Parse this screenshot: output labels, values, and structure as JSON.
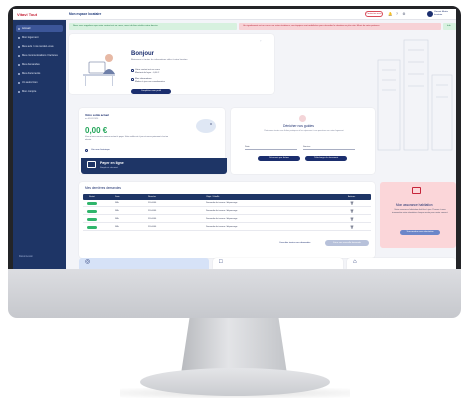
{
  "header": {
    "logo": "Vitavi Tout",
    "space_title": "Mon espace locataire",
    "contact_label": "Contactez-nous",
    "user_name": "Vincent Martin",
    "user_sub": "locataire"
  },
  "sidebar": {
    "items": [
      {
        "label": "Accueil"
      },
      {
        "label": "Mon logement"
      },
      {
        "label": "Mes avis / nos rendez-vous"
      },
      {
        "label": "Mes communications / factures"
      },
      {
        "label": "Mes demandes"
      },
      {
        "label": "Mes documents"
      },
      {
        "label": "Un autre bien"
      },
      {
        "label": "Mon compte"
      }
    ],
    "footer": "Déconnexion"
  },
  "alerts": {
    "green": "Nous vous rappelons que votre contrat est en cours, merci de bien vérifier votre dossier",
    "red": "Un signalement est en cours sur votre résidence, nos équipes sont mobilisées pour résoudre la situation au plus vite. Merci de votre patience",
    "green2": "Info"
  },
  "hero": {
    "title": "Bonjour",
    "subtitle": "Retrouvez ici toutes les informations utiles à votre location",
    "line1": "Votre contrat est en cours",
    "line1b": "Montant du loyer : 0,00 €",
    "line2": "Mes informations",
    "line2b": "Mettez à jour vos coordonnées",
    "button": "Compléter mon profil"
  },
  "balance": {
    "title": "Votre solde actuel",
    "date": "au 01/01/2024",
    "amount": "0,00 €",
    "text": "Vous n'avez aucune somme restant à payer. Votre solde est à jour et aucun paiement n'est en attente.",
    "link": "Voir mon historique",
    "pay_title": "Payer en ligne",
    "pay_sub": "Simple et sécurisé"
  },
  "guide": {
    "title": "Dénicher nos guides",
    "subtitle": "Retrouvez toutes nos fiches pratiques et les réponses à vos questions sur votre logement",
    "field1": "Date",
    "field2": "Service",
    "button1": "Découvrir par thème",
    "button2": "Télécharger le document"
  },
  "requests": {
    "title": "Mes dernières demandes",
    "columns": [
      "Statut",
      "Date",
      "Numéro",
      "Objet / Libellé",
      "Actions"
    ],
    "rows": [
      {
        "date": "N/A",
        "number": "DX-0000",
        "object": "Demande de travaux / dépannage"
      },
      {
        "date": "N/A",
        "number": "DX-0000",
        "object": "Demande de travaux / dépannage"
      },
      {
        "date": "N/A",
        "number": "DX-0000",
        "object": "Demande de travaux / dépannage"
      },
      {
        "date": "N/A",
        "number": "DX-0000",
        "object": "Demande de travaux / dépannage"
      }
    ],
    "view_all": "Consulter toutes mes demandes",
    "new_button": "Faire une nouvelle demande"
  },
  "promo": {
    "title": "Mon assurance habitation",
    "text": "Votre assurance habitation doit être à jour. Pensez à nous transmettre votre attestation chaque année pour rester couvert.",
    "button": "Transmettre mon attestation"
  },
  "colors": {
    "navy": "#1e3566",
    "brand_red": "#c6253a",
    "success": "#23a559",
    "alert_red_bg": "#f7d2d6"
  },
  "icons": [
    "bell-icon",
    "gear-icon",
    "credit-card-icon",
    "lightbulb-icon",
    "trash-icon",
    "shield-icon",
    "document-icon",
    "home-icon"
  ]
}
